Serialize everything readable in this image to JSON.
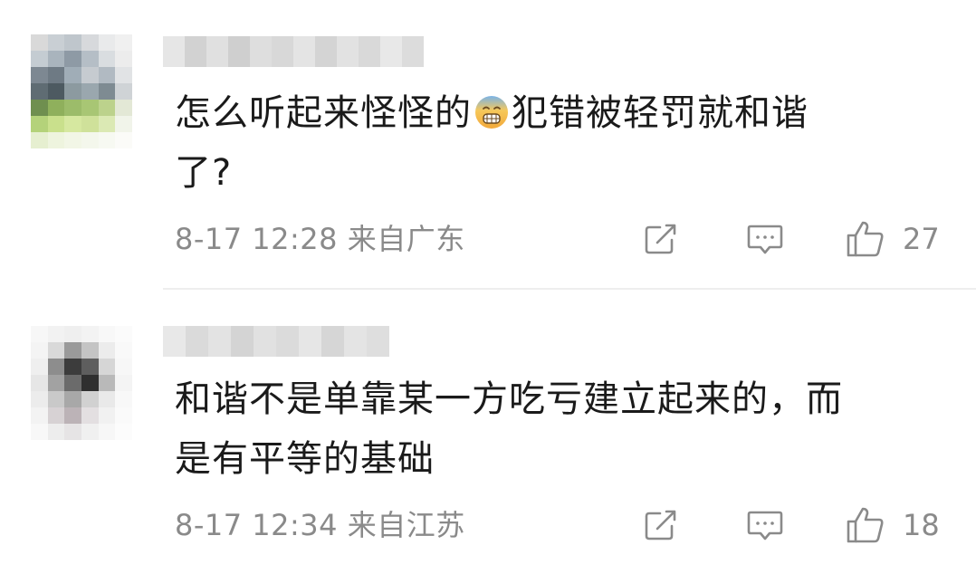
{
  "comments": [
    {
      "text": "怎么听起来怪怪的",
      "emoji": "cold-sweat-emoji",
      "text_after_emoji": "犯错被轻罚就和谐\n了?",
      "date": "8-17 12:28",
      "location": "来自广东",
      "likes": "27",
      "avatar_colors": [
        "#d9d9d9",
        "#c9cfd4",
        "#bfc6cc",
        "#d7d9dc",
        "#e9eaeb",
        "#f0f0f0",
        "#c4ccd2",
        "#a9b4bd",
        "#8e9aa5",
        "#b5bec6",
        "#d9dde0",
        "#ececec",
        "#7d8892",
        "#6e7a84",
        "#a0adb7",
        "#c6cbd0",
        "#b1bac2",
        "#e1e3e5",
        "#5f6c73",
        "#4d5a61",
        "#8c9aa0",
        "#9aa7ae",
        "#7e8b92",
        "#cfd3d6",
        "#6f8f4f",
        "#8fb05c",
        "#9cbc6a",
        "#a8c674",
        "#bcd28c",
        "#e3e8d6",
        "#b4d27a",
        "#c9e08c",
        "#d6e8a0",
        "#cfe19a",
        "#dbe9b4",
        "#f1f4ea",
        "#e6efd0",
        "#eef4de",
        "#f2f6e6",
        "#f4f7ec",
        "#f7f9f2",
        "#fbfbf8"
      ],
      "username_colors": [
        "#e6e6e6",
        "#d2d2d2",
        "#e0e0e0",
        "#cfcfcf",
        "#dedede",
        "#d8d8d8",
        "#e4e4e4",
        "#d4d4d4",
        "#e2e2e2",
        "#d9d9d9",
        "#e8e8e8",
        "#dcdcdc"
      ]
    },
    {
      "text": "和谐不是单靠某一方吃亏建立起来的，而\n是有平等的基础",
      "date": "8-17 12:34",
      "location": "来自江苏",
      "likes": "18",
      "avatar_colors": [
        "#f7f7f7",
        "#f2f2f2",
        "#efefef",
        "#f3f3f3",
        "#f8f8f8",
        "#fbfbfb",
        "#f4f4f4",
        "#d9d9d9",
        "#9a9a9a",
        "#c4c4c4",
        "#ececec",
        "#f9f9f9",
        "#efefef",
        "#8d8d8d",
        "#3c3c3c",
        "#5e5e5e",
        "#d6d6d6",
        "#f7f7f7",
        "#e6e6e6",
        "#a2a2a2",
        "#6b6b6b",
        "#2f2f2f",
        "#b9b9b9",
        "#f4f4f4",
        "#ececec",
        "#c9c9c9",
        "#a8a8a8",
        "#d1d1d1",
        "#e9e9e9",
        "#f8f8f8",
        "#f3f3f3",
        "#d7d2d4",
        "#bcb3b7",
        "#e3dfe1",
        "#f1f1f1",
        "#fafafa",
        "#f8f8f8",
        "#ededed",
        "#e6e4e5",
        "#f0f0f0",
        "#f7f7f7",
        "#fcfcfc"
      ],
      "username_colors": [
        "#e8e8e8",
        "#dadada",
        "#e3e3e3",
        "#d4d4d4",
        "#e1e1e1",
        "#dbdbdb",
        "#e6e6e6",
        "#d6d6d6",
        "#e4e4e4",
        "#dedede"
      ]
    }
  ],
  "icons": {
    "share": "share-icon",
    "reply": "comment-icon",
    "like": "thumbs-up-icon"
  },
  "colors": {
    "text": "#1a1a1a",
    "meta": "#8a8a8a",
    "divider": "#eeeeee"
  }
}
